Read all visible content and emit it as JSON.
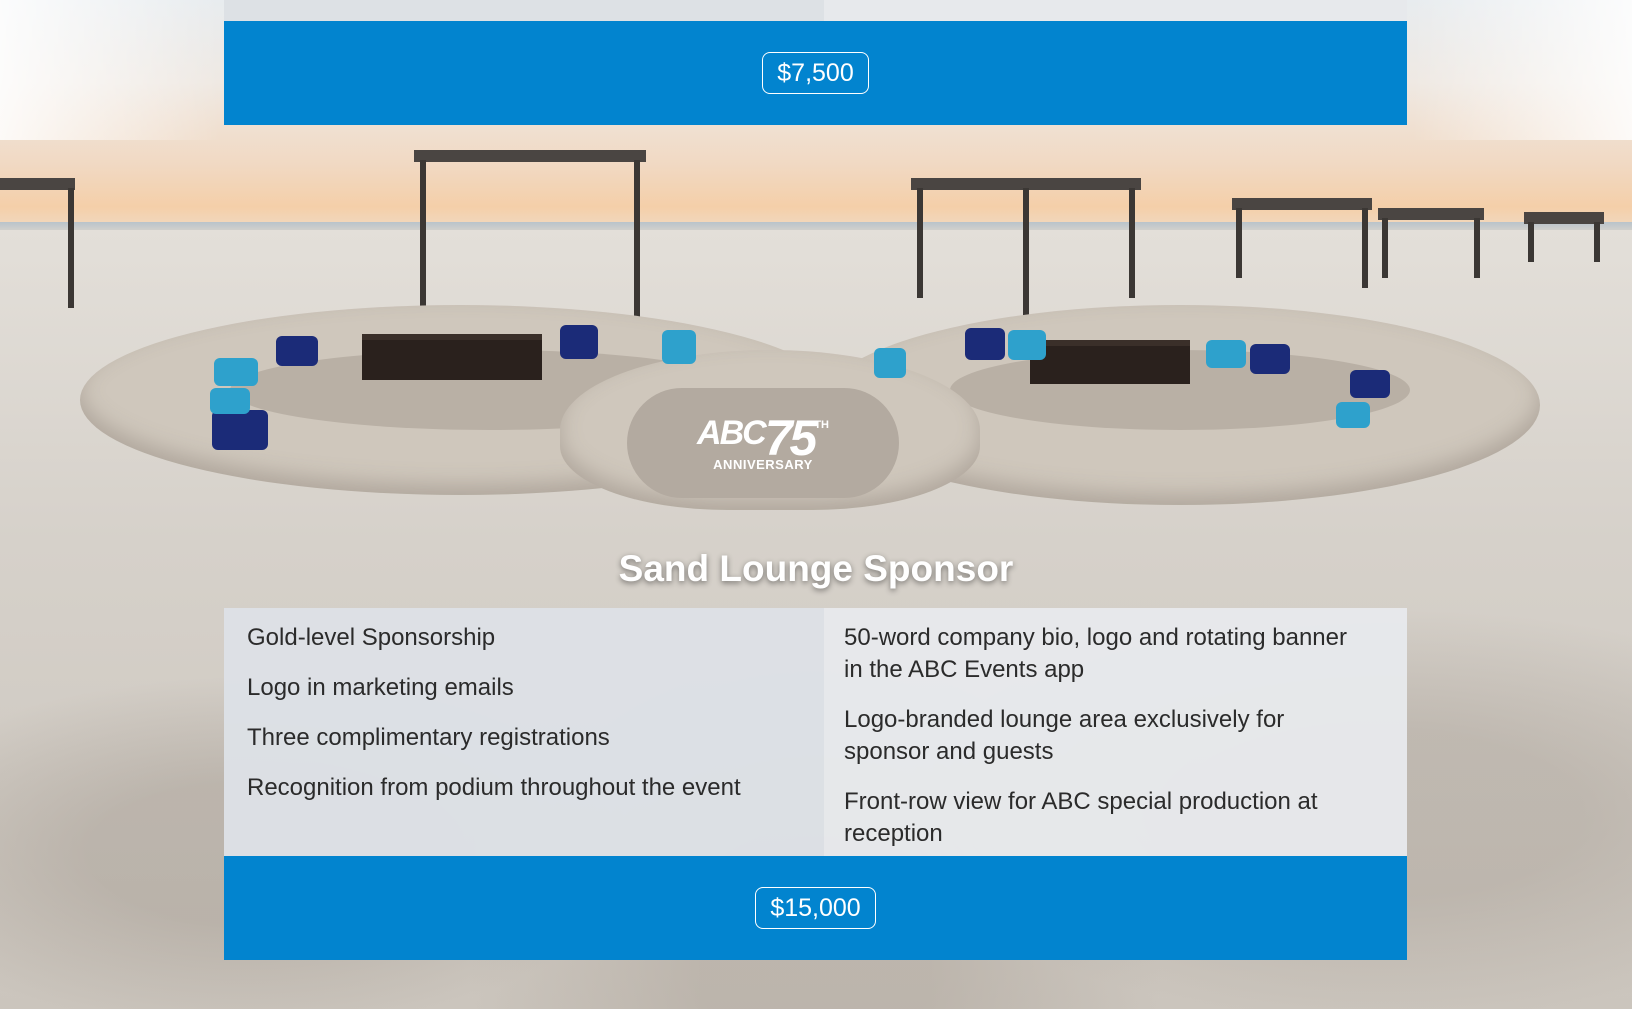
{
  "upper_card": {
    "price": "$7,500"
  },
  "sponsor": {
    "title": "Sand Lounge Sponsor",
    "left_items": [
      "Gold-level Sponsorship",
      "Logo in marketing emails",
      "Three complimentary registrations",
      "Recognition from podium throughout the event"
    ],
    "right_items": [
      "50-word company bio, logo and rotating banner in the ABC Events app",
      "Logo-branded lounge area exclusively for sponsor and guests",
      "Front-row view for ABC special production at reception"
    ],
    "price": "$15,000"
  },
  "logo": {
    "brand": "ABC",
    "number": "75",
    "suffix": "TH",
    "caption": "ANNIVERSARY"
  },
  "colors": {
    "accent_blue": "#0284cf",
    "panel_left": "#dde1e5",
    "panel_right": "#e7e9ec"
  }
}
